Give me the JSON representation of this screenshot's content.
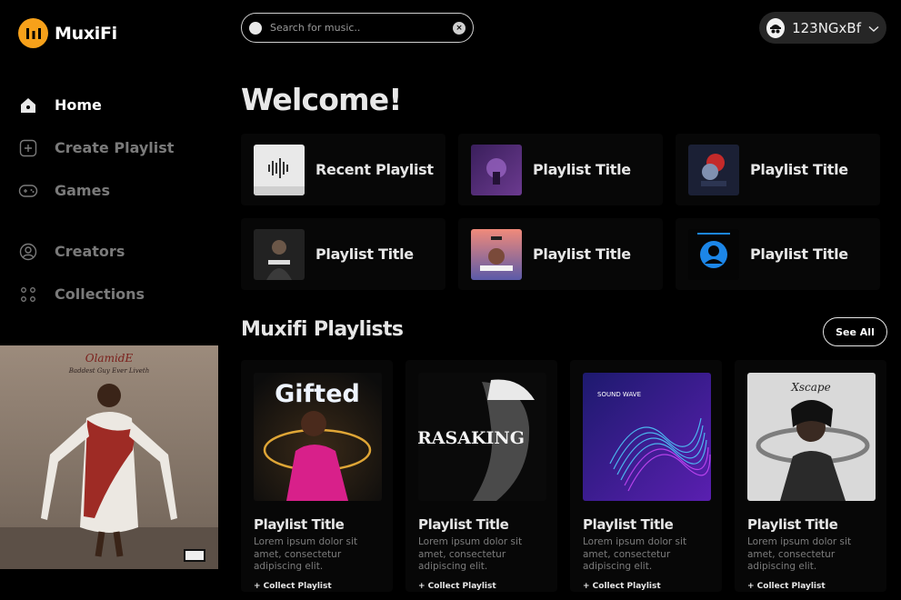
{
  "app": {
    "name": "MuxiFi"
  },
  "sidebar": {
    "items": [
      {
        "label": "Home",
        "icon": "home-icon",
        "active": true
      },
      {
        "label": "Create Playlist",
        "icon": "add-square-icon",
        "active": false
      },
      {
        "label": "Games",
        "icon": "gamepad-icon",
        "active": false
      },
      {
        "label": "Creators",
        "icon": "user-circle-icon",
        "active": false
      },
      {
        "label": "Collections",
        "icon": "grid-dots-icon",
        "active": false
      }
    ],
    "now_playing_art": {
      "artist_text": "OlamidE",
      "album_text": "Baddest Guy Ever Liveth"
    }
  },
  "search": {
    "placeholder": "Search for music..",
    "value": ""
  },
  "user": {
    "name": "123NGxBf",
    "chevron": "chevron-down-icon"
  },
  "main": {
    "heading": "Welcome!",
    "quick_tiles": [
      {
        "title": "Recent Playlist"
      },
      {
        "title": "Playlist Title"
      },
      {
        "title": "Playlist Title"
      },
      {
        "title": "Playlist Title"
      },
      {
        "title": "Playlist Title"
      },
      {
        "title": "Playlist Title"
      }
    ],
    "section_title": "Muxifi Playlists",
    "see_all_label": "See All",
    "playlists": [
      {
        "cover_text": "Gifted",
        "title": "Playlist Title",
        "desc": "Lorem ipsum dolor sit amet, consectetur adipiscing elit.",
        "collect": "+ Collect Playlist"
      },
      {
        "cover_text": "RASAKING",
        "title": "Playlist Title",
        "desc": "Lorem ipsum dolor sit amet, consectetur adipiscing elit.",
        "collect": "+ Collect Playlist"
      },
      {
        "cover_text": "SOUND WAVE",
        "title": "Playlist Title",
        "desc": "Lorem ipsum dolor sit amet, consectetur adipiscing elit.",
        "collect": "+ Collect Playlist"
      },
      {
        "cover_text": "Xscape",
        "title": "Playlist Title",
        "desc": "Lorem ipsum dolor sit amet, consectetur adipiscing elit.",
        "collect": "+ Collect Playlist"
      }
    ]
  },
  "colors": {
    "brand": "#f7a11a",
    "background": "#000000",
    "surface": "#070707",
    "muted_text": "#7a7a7a"
  }
}
